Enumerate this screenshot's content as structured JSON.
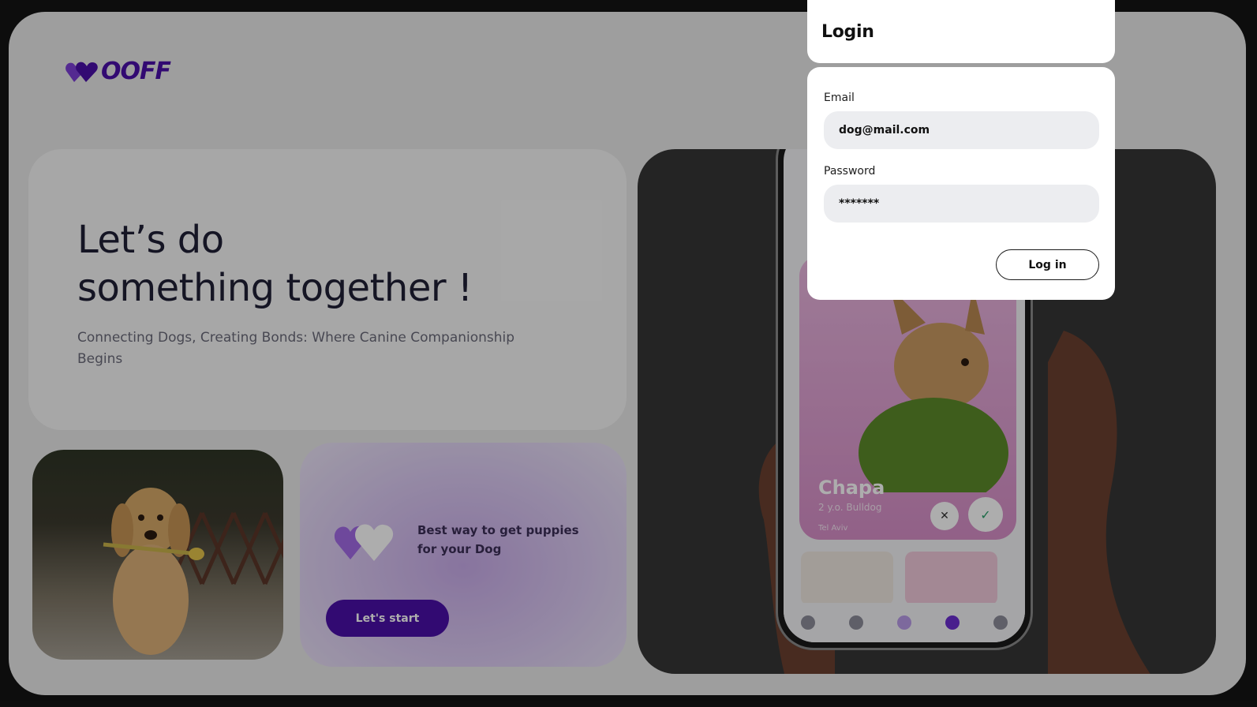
{
  "brand": {
    "logo_text": "OOFF",
    "logo_full": "WOOFF",
    "color": "#4b0fa8"
  },
  "hero": {
    "title": "Let’s do\nsomething together !",
    "subtitle": "Connecting Dogs, Creating Bonds: Where Canine Companionship Begins"
  },
  "promo": {
    "text": "Best way to get puppies for your Dog",
    "cta_label": "Let's start"
  },
  "phone_app": {
    "pet_name": "Chapa",
    "pet_meta": "2 y.o. Bulldog",
    "pet_location": "Tel Aviv",
    "icons": [
      "home-icon",
      "profile-icon",
      "heart-icon",
      "chat-icon",
      "paw-icon"
    ]
  },
  "login": {
    "title": "Login",
    "email_label": "Email",
    "email_value": "dog@mail.com",
    "password_label": "Password",
    "password_value": "*******",
    "submit_label": "Log in"
  },
  "colors": {
    "accent": "#4b0fa8",
    "promo_bg": "#dccbf3",
    "input_bg": "#ecedf0",
    "backdrop": "#141414"
  }
}
